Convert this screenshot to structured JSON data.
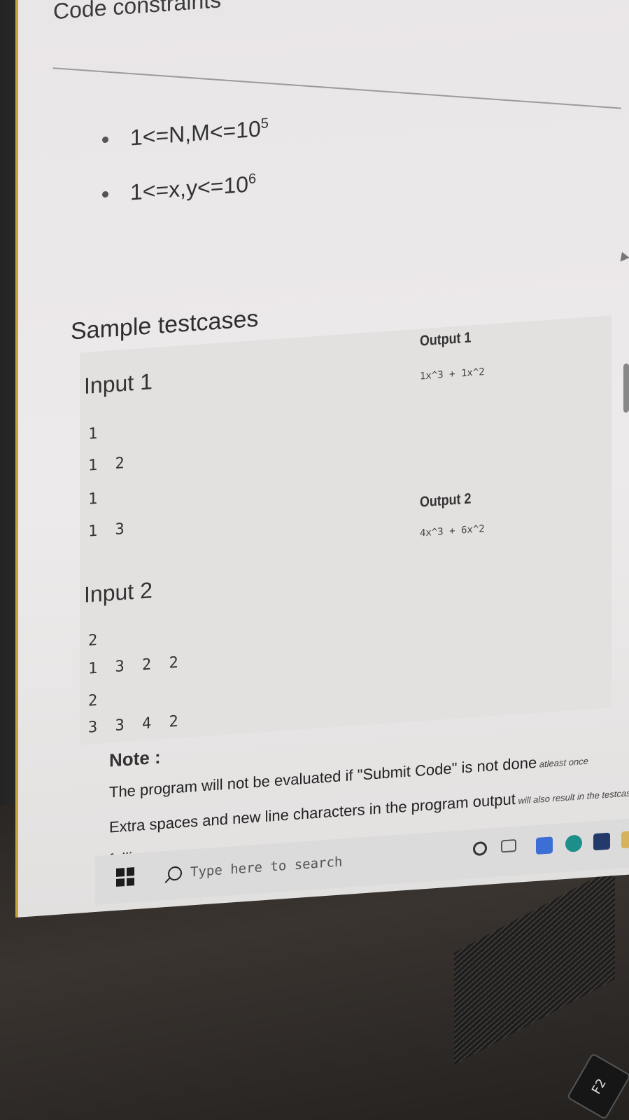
{
  "constraints": {
    "heading": "Code constraints",
    "items": [
      {
        "base": "1<=N,M<=10",
        "exp": "5"
      },
      {
        "base": "1<=x,y<=10",
        "exp": "6"
      }
    ]
  },
  "samples": {
    "heading": "Sample testcases",
    "testcases": [
      {
        "input_label": "Input 1",
        "input_lines": [
          "1",
          "1 2",
          "1",
          "1 3"
        ],
        "output_label": "Output 1",
        "output_value": "1x^3 + 1x^2"
      },
      {
        "input_label": "Input 2",
        "input_lines": [
          "2",
          "1 3 2 2",
          "2",
          "3 3 4 2"
        ],
        "output_label": "Output 2",
        "output_value": "4x^3 + 6x^2"
      }
    ]
  },
  "note": {
    "title": "Note :",
    "line1_main": "The program will not be evaluated if \"Submit Code\" is not done",
    "line1_tail": " atleast once",
    "line2_main": "Extra spaces and new line characters in the program output",
    "line2_tail": " will also result in the testcase",
    "line3": "failing"
  },
  "taskbar": {
    "search_placeholder": "Type here to search",
    "start_icon": "windows-logo-icon",
    "tray_icons": [
      "cortana-icon",
      "task-view-icon",
      "app-icon",
      "edge-icon",
      "app-icon",
      "folder-icon"
    ]
  },
  "keyboard": {
    "visible_key": "F2"
  }
}
